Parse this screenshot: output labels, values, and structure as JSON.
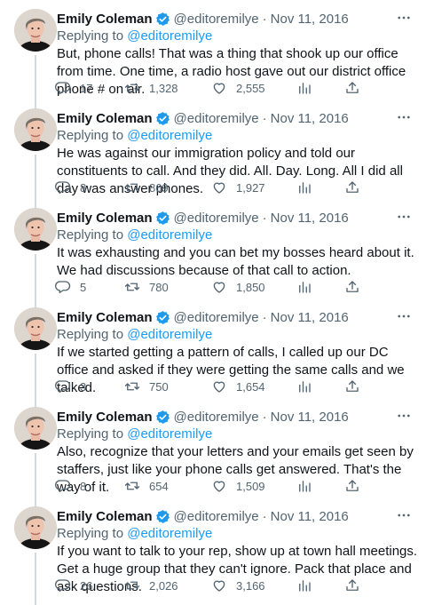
{
  "author": {
    "name": "Emily Coleman",
    "handle": "@editoremilye",
    "separator": "·",
    "replying_prefix": "Replying to",
    "replying_to": "@editoremilye"
  },
  "colors": {
    "accent": "#1d9bf0",
    "secondary_text": "#536471",
    "primary_text": "#0f1419",
    "thread_line": "#cfd9de"
  },
  "icons": {
    "verified": "verified-badge-icon",
    "more": "more-horizontal-icon",
    "reply": "reply-icon",
    "retweet": "retweet-icon",
    "like": "heart-icon",
    "views": "views-bar-chart-icon",
    "share": "share-icon"
  },
  "tweets": [
    {
      "date": "Nov 11, 2016",
      "text": "But, phone calls! That was a thing that shook up our office from time. One time, a radio host gave out our district office phone # on air.",
      "replies": "17",
      "retweets": "1,328",
      "likes": "2,555"
    },
    {
      "date": "Nov 11, 2016",
      "text": "He was against our immigration policy and told our constituents to call. And they did. All. Day. Long. All I did all day was answer phones.",
      "replies": "8",
      "retweets": "869",
      "likes": "1,927"
    },
    {
      "date": "Nov 11, 2016",
      "text": "It was exhausting and you can bet my bosses heard about it. We had discussions because of that call to action.",
      "replies": "5",
      "retweets": "780",
      "likes": "1,850"
    },
    {
      "date": "Nov 11, 2016",
      "text": "If we started getting a pattern of calls, I called up our DC office and asked if they were getting the same calls and we talked.",
      "replies": "3",
      "retweets": "750",
      "likes": "1,654"
    },
    {
      "date": "Nov 11, 2016",
      "text": "Also, recognize that your letters and your emails get seen by staffers, just like your phone calls get answered. That's the way of it.",
      "replies": "8",
      "retweets": "654",
      "likes": "1,509"
    },
    {
      "date": "Nov 11, 2016",
      "text": "If you want to talk to your rep, show up at town hall meetings. Get a huge group that they can't ignore. Pack that place and ask questions.",
      "replies": "26",
      "retweets": "2,026",
      "likes": "3,166"
    }
  ]
}
